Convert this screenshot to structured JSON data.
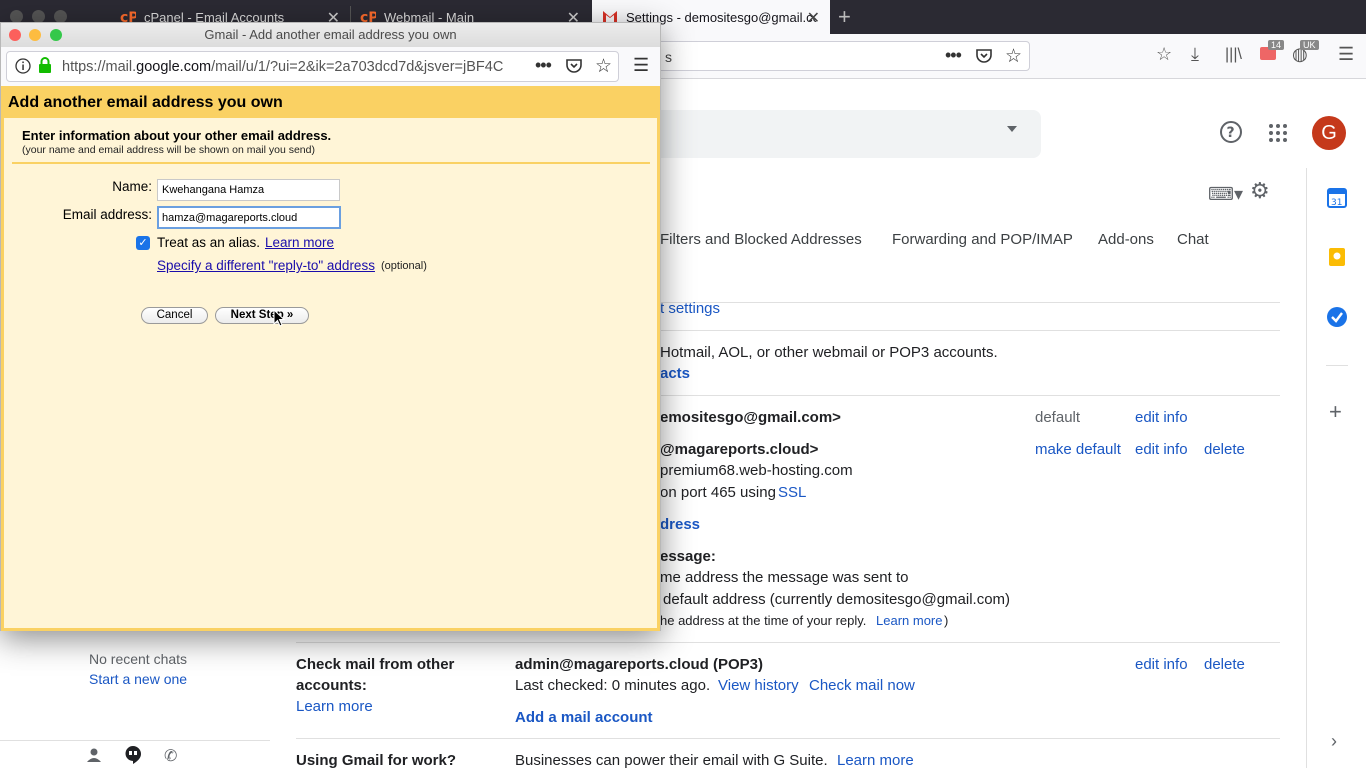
{
  "tabs": [
    {
      "label": "cPanel - Email Accounts"
    },
    {
      "label": "Webmail - Main"
    },
    {
      "label": "Settings - demositesgo@gmail.com"
    }
  ],
  "main_url_fragment": "s",
  "toolbar": {
    "badge_count": "14",
    "badge_uk": "UK"
  },
  "gmail": {
    "avatar_letter": "G",
    "tabs": [
      "Filters and Blocked Addresses",
      "Forwarding and POP/IMAP",
      "Add-ons",
      "Chat"
    ],
    "import_settings_link": "t settings",
    "import_desc": "Hotmail, AOL, or other webmail or POP3 accounts.",
    "import_contacts_link": "acts",
    "addr1": "emositesgo@gmail.com>",
    "addr1_default": "default",
    "edit_info": "edit info",
    "make_default": "make default",
    "delete": "delete",
    "addr2": "@magareports.cloud>",
    "addr2_server": "premium68.web-hosting.com",
    "addr2_port_prefix": "on port 465 using",
    "addr2_ssl": "SSL",
    "add_address_link": "dress",
    "reply_heading": "essage:",
    "reply_opt1": "me address the message was sent to",
    "reply_opt2": "default address (currently demositesgo@gmail.com)",
    "reply_note": "he address at the time of your reply.",
    "learn_more": "Learn more",
    "check_mail_heading_1": "Check mail from other",
    "check_mail_heading_2": "accounts:",
    "check_account": "admin@magareports.cloud (POP3)",
    "last_checked": "Last checked: 0 minutes ago.",
    "view_history": "View history",
    "check_mail_now": "Check mail now",
    "add_mail_account": "Add a mail account",
    "using_gmail_work": "Using Gmail for work?",
    "gsuite_text": "Businesses can power their email with G Suite.",
    "no_recent_chats": "No recent chats",
    "start_new_one": "Start a new one"
  },
  "popup": {
    "window_title": "Gmail - Add another email address you own",
    "url_prefix": "https://mail.",
    "url_domain": "google.com",
    "url_rest": "/mail/u/1/?ui=2&ik=2a703dcd7d&jsver=jBF4C",
    "heading": "Add another email address you own",
    "subheading": "Enter information about your other email address.",
    "subnote": "(your name and email address will be shown on mail you send)",
    "name_label": "Name:",
    "name_value": "Kwehangana Hamza",
    "email_label": "Email address:",
    "email_value": "hamza@magareports.cloud",
    "alias_label": "Treat as an alias.",
    "alias_learn_more": "Learn more",
    "reply_to_link": "Specify a different \"reply-to\" address",
    "optional": "(optional)",
    "cancel": "Cancel",
    "next_step": "Next Step »"
  },
  "colors": {
    "accent_yellow": "#fad163",
    "popup_bg": "#fff5d7",
    "link": "#1a57c4",
    "avatar": "#c5391b"
  }
}
